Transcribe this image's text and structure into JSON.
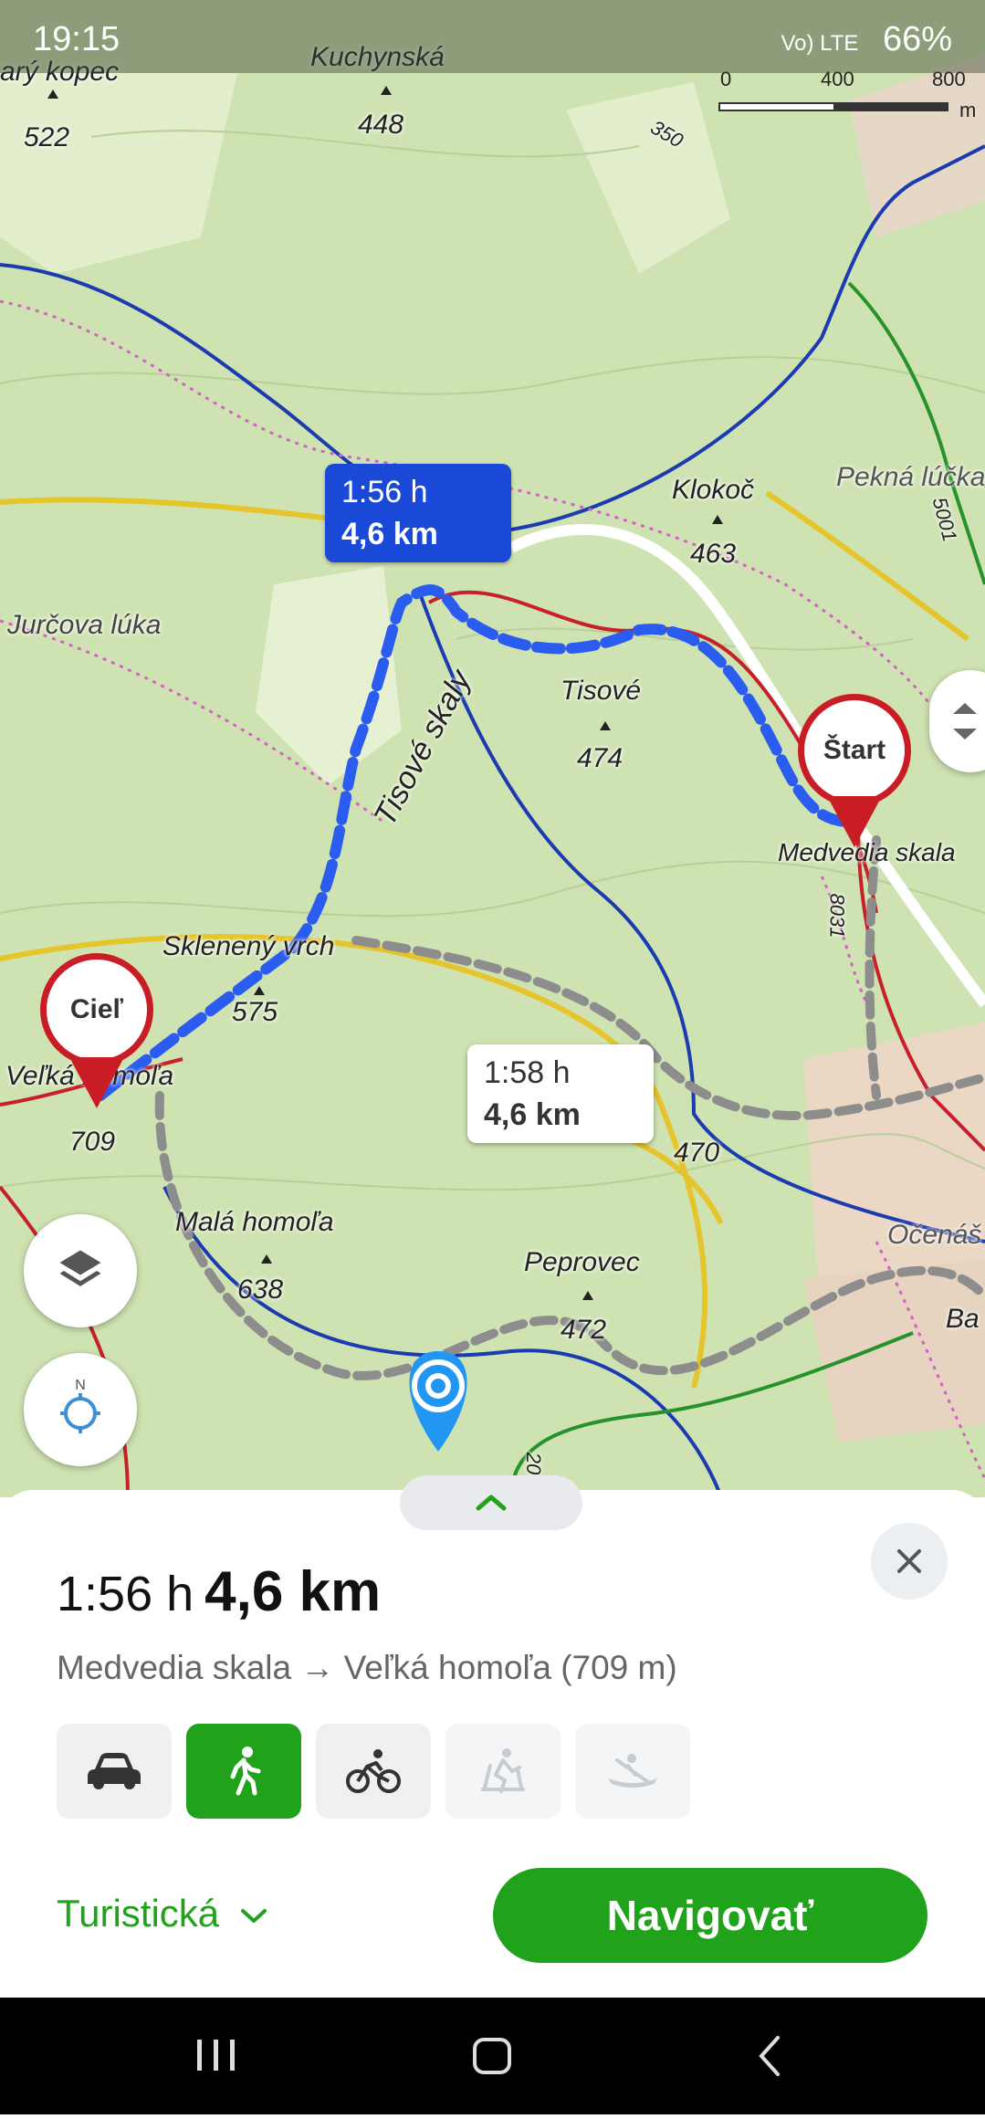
{
  "status_bar": {
    "time": "19:15",
    "battery": "66%",
    "network": "Vo) LTE"
  },
  "scale_bar": {
    "ticks": [
      "0",
      "400",
      "800"
    ],
    "unit": "m"
  },
  "map_labels": {
    "kuchynska": "Kuchynská",
    "stary_kopec": "arý kopec",
    "klokoc": "Klokoč",
    "pekna_lucka": "Pekná lúčka",
    "jurcova_luka": "Jurčova lúka",
    "tisove": "Tisové",
    "tisove_skaly": "Tisové skaly",
    "medvedia_skala": "Medvedia skala",
    "skleneny_vrch": "Sklenený vrch",
    "velka_homola": "Veľká homoľa",
    "mala_homola": "Malá homoľa",
    "peprovec": "Peprovec",
    "ocenas": "Očenáš",
    "ba": "Ba"
  },
  "elevations": {
    "e522": "522",
    "e448": "448",
    "e463": "463",
    "e474": "474",
    "e575": "575",
    "e709": "709",
    "e638": "638",
    "e470": "470",
    "e472": "472"
  },
  "route_numbers": {
    "r350": "350",
    "r5001": "5001",
    "r8031": "8031",
    "r20": "20"
  },
  "active_route_bubble": {
    "time": "1:56 h",
    "distance": "4,6 km"
  },
  "alt_route_bubble": {
    "time": "1:58 h",
    "distance": "4,6 km"
  },
  "pins": {
    "start": "Štart",
    "finish": "Cieľ"
  },
  "route_sheet": {
    "time": "1:56 h",
    "distance": "4,6 km",
    "description": "Medvedia skala → Veľká homoľa (709 m)",
    "modes": [
      {
        "icon": "car-icon",
        "state": "normal"
      },
      {
        "icon": "walking-icon",
        "state": "active"
      },
      {
        "icon": "bicycle-icon",
        "state": "normal"
      },
      {
        "icon": "skiing-icon",
        "state": "disabled"
      },
      {
        "icon": "canoe-icon",
        "state": "disabled"
      }
    ],
    "route_type": "Turistická",
    "navigate_label": "Navigovať"
  },
  "colors": {
    "accent_green": "#20a31b",
    "route_blue": "#1a49d8",
    "pin_red": "#c91c24",
    "map_bg": "#cfe3b2"
  }
}
